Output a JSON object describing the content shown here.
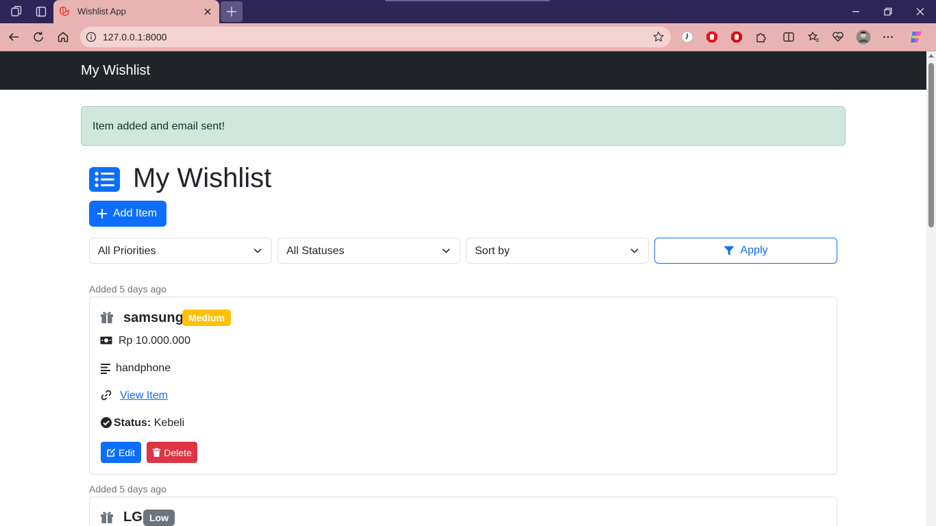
{
  "browser": {
    "tab_title": "Wishlist App",
    "url": "127.0.0.1:8000"
  },
  "navbar": {
    "brand": "My Wishlist"
  },
  "alert": {
    "message": "Item added and email sent!"
  },
  "page": {
    "title": "My Wishlist",
    "add_button": "Add Item",
    "filters": {
      "priority": "All Priorities",
      "status": "All Statuses",
      "sort": "Sort by",
      "apply": "Apply"
    }
  },
  "items": [
    {
      "added": "Added 5 days ago",
      "name": "samsung",
      "priority": "Medium",
      "price": "Rp 10.000.000",
      "description": "handphone",
      "link_text": "View Item",
      "status_label": "Status:",
      "status": "Kebeli",
      "edit": "Edit",
      "delete": "Delete"
    },
    {
      "added": "Added 5 days ago",
      "name": "LG",
      "priority": "Low"
    }
  ],
  "colors": {
    "primary": "#0d6efd",
    "danger": "#dc3545",
    "warning": "#ffc107",
    "secondary": "#6c757d",
    "navbar": "#212529",
    "alert_bg": "#d1e7dd"
  }
}
